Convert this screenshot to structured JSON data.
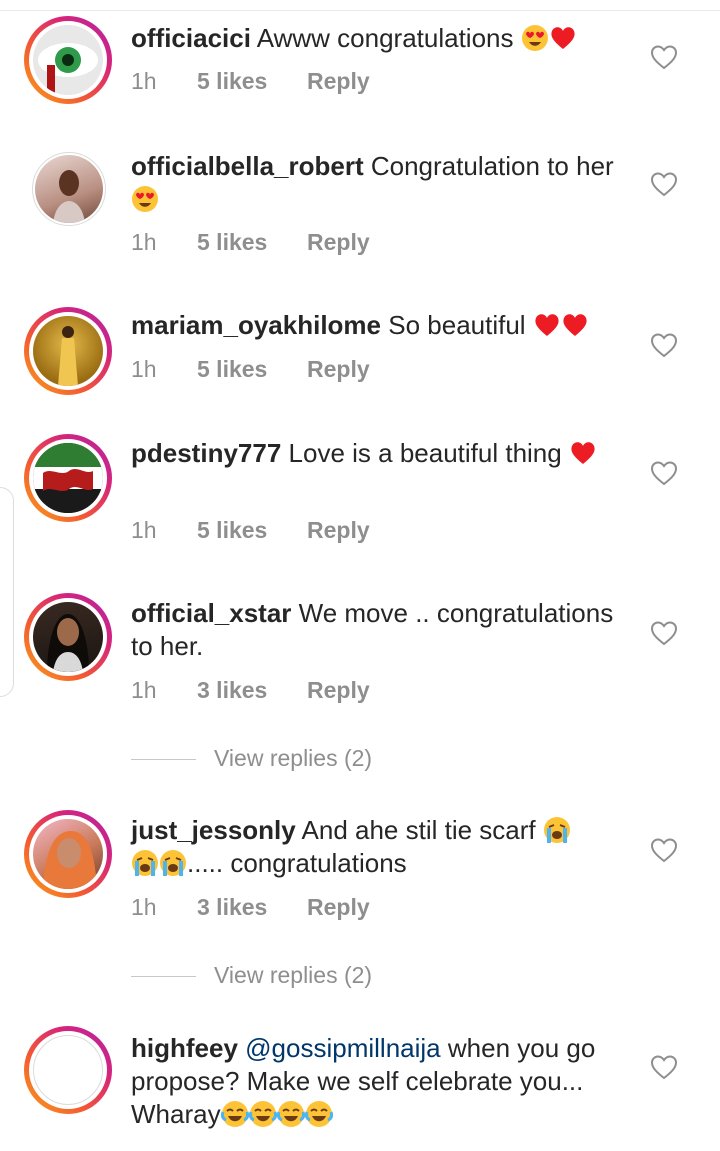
{
  "comments": [
    {
      "username": "officiacici",
      "text": "Awww congratulations",
      "emoji": [
        "heart-eyes",
        "red-heart"
      ],
      "time": "1h",
      "likes": "5 likes",
      "reply": "Reply",
      "avatar": "green-eye"
    },
    {
      "username": "officialbella_robert",
      "text": "Congratulation to her",
      "emoji": [
        "heart-eyes"
      ],
      "time": "1h",
      "likes": "5 likes",
      "reply": "Reply",
      "avatar": "portrait"
    },
    {
      "username": "mariam_oyakhilome",
      "text": "So beautiful",
      "emoji": [
        "red-heart",
        "red-heart"
      ],
      "time": "1h",
      "likes": "5 likes",
      "reply": "Reply",
      "avatar": "gold-dress"
    },
    {
      "username": "pdestiny777",
      "text": "Love is a beautiful thing",
      "emoji": [
        "red-heart"
      ],
      "time": "1h",
      "likes": "5 likes",
      "reply": "Reply",
      "avatar": "flag"
    },
    {
      "username": "official_xstar",
      "text": "We move .. congratulations to her.",
      "emoji": [],
      "time": "1h",
      "likes": "3 likes",
      "reply": "Reply",
      "view_replies": "View replies (2)",
      "avatar": "portrait-dark"
    },
    {
      "username": "just_jessonly",
      "text": "And ahe stil tie scarf",
      "text_after": "..... congratulations",
      "emoji": [
        "crying-face"
      ],
      "emoji_after": [
        "crying-face",
        "crying-face"
      ],
      "time": "1h",
      "likes": "3 likes",
      "reply": "Reply",
      "view_replies": "View replies (2)",
      "avatar": "portrait-orange"
    },
    {
      "username": "highfeey",
      "mention": "@gossipmillnaija",
      "text": "when you go propose? Make we self celebrate you... Wharay",
      "emoji": [
        "tears-of-joy",
        "tears-of-joy",
        "tears-of-joy",
        "tears-of-joy"
      ],
      "avatar": "default"
    }
  ],
  "colors": {
    "username": "#262626",
    "meta": "#8e8e8e",
    "mention": "#00376b",
    "heart": "#ed1c24"
  }
}
